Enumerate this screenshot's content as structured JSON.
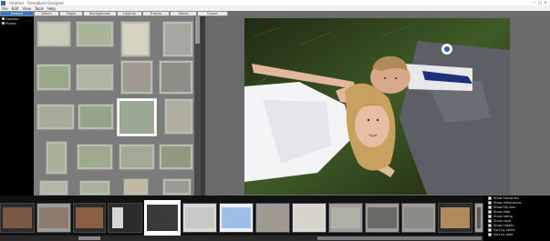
{
  "window": {
    "title": "Untitled - Fotoalbum Designer",
    "controls": [
      "–",
      "□",
      "×"
    ]
  },
  "menu": [
    "File",
    "Edit",
    "View",
    "Tools",
    "Help"
  ],
  "tabs": [
    {
      "label": "Browse",
      "active": true
    },
    {
      "label": "Album",
      "active": false
    },
    {
      "label": "Pages",
      "active": false
    },
    {
      "label": "Backgrounds",
      "active": false
    },
    {
      "label": "Layouts",
      "active": false
    },
    {
      "label": "Frames",
      "active": false
    },
    {
      "label": "Masks",
      "active": false
    },
    {
      "label": "Export",
      "active": false
    }
  ],
  "tree": [
    {
      "label": "Desktop"
    },
    {
      "label": "Photos"
    }
  ],
  "options": [
    "Show filenames",
    "Show dimensions",
    "Show file size",
    "Show date",
    "Show rating",
    "Show used",
    "Show hidden",
    "Sort by name",
    "Sort by date"
  ],
  "colors": {
    "accent": "#3478c6",
    "panel_dark": "#000000",
    "workspace": "#6a6a6a",
    "thumb_panel": "#7b7b7b"
  }
}
